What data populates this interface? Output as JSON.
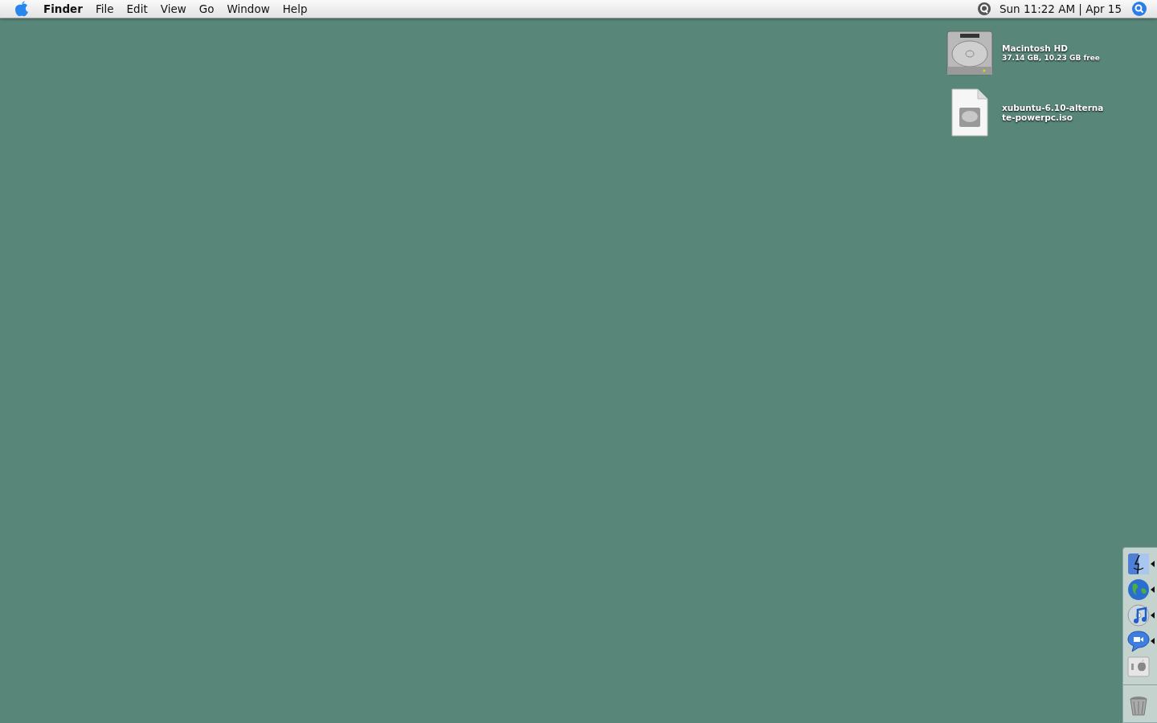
{
  "menu_bar": {
    "app_name": "Finder",
    "menus": [
      "File",
      "Edit",
      "View",
      "Go",
      "Window",
      "Help"
    ],
    "clock": "Sun 11:22 AM | Apr 15"
  },
  "desktop_icons": [
    {
      "kind": "drive",
      "name": "Macintosh HD",
      "info": "37.14 GB, 10.23 GB free"
    },
    {
      "kind": "disk-image",
      "name": "xubuntu-6.10-alternate-powerpc.iso"
    }
  ],
  "dock": {
    "apps": [
      {
        "kind": "finder",
        "running": true
      },
      {
        "kind": "globe",
        "running": true
      },
      {
        "kind": "music",
        "running": true
      },
      {
        "kind": "chat",
        "running": true
      },
      {
        "kind": "switch",
        "running": false
      }
    ],
    "trash": {
      "kind": "trash"
    }
  }
}
